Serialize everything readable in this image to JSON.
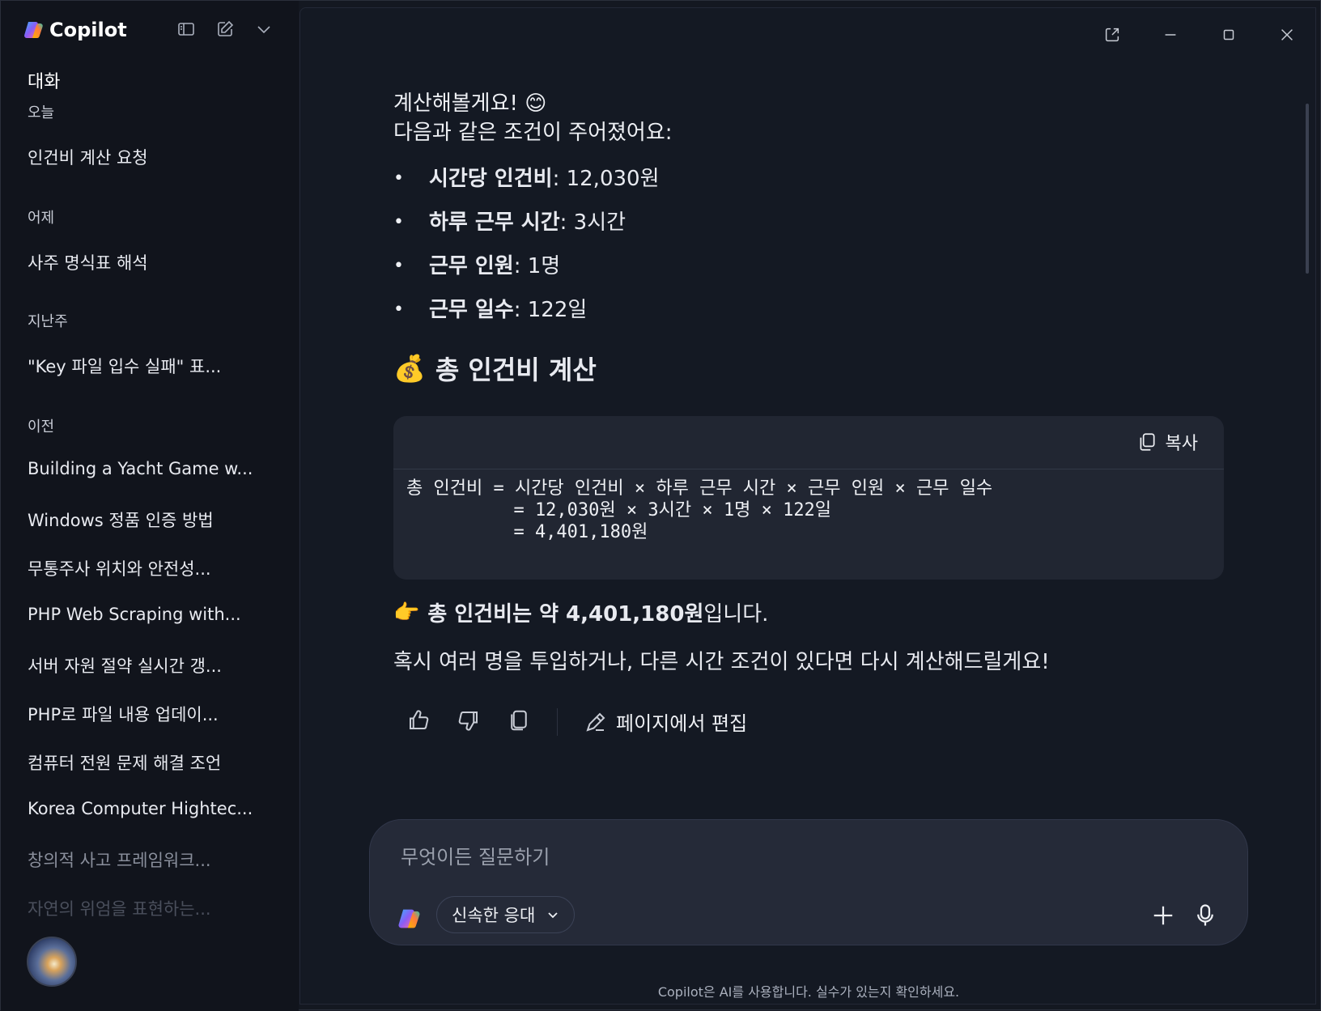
{
  "app": {
    "title": "Copilot"
  },
  "sidebar": {
    "heading": "대화",
    "groups": [
      {
        "label": "오늘",
        "items": [
          "인건비 계산 요청"
        ]
      },
      {
        "label": "어제",
        "items": [
          "사주 명식표 해석"
        ]
      },
      {
        "label": "지난주",
        "items": [
          "\"Key 파일 입수 실패\" 표..."
        ]
      },
      {
        "label": "이전",
        "items": [
          "Building a Yacht Game w...",
          "Windows 정품 인증 방법",
          "무통주사 위치와 안전성...",
          "PHP Web Scraping with...",
          "서버 자원 절약 실시간 갱...",
          "PHP로 파일 내용 업데이...",
          "컴퓨터 전원 문제 해결 조언",
          "Korea Computer Hightec...",
          "창의적 사고 프레임워크...",
          "자연의 위엄을 표현하는..."
        ]
      }
    ]
  },
  "message": {
    "intro_line1": "계산해볼게요! 😊",
    "intro_line2": "다음과 같은 조건이 주어졌어요:",
    "bullets": [
      {
        "label": "시간당 인건비",
        "value": ": 12,030원"
      },
      {
        "label": "하루 근무 시간",
        "value": ": 3시간"
      },
      {
        "label": "근무 인원",
        "value": ": 1명"
      },
      {
        "label": "근무 일수",
        "value": ": 122일"
      }
    ],
    "section_emoji": "💰",
    "section_title": "총 인건비 계산",
    "code_copy_label": "복사",
    "code": "총 인건비 = 시간당 인건비 × 하루 근무 시간 × 근무 인원 × 근무 일수\n          = 12,030원 × 3시간 × 1명 × 122일\n          = 4,401,180원",
    "result_emoji": "👉",
    "result_bold": "총 인건비는 약 4,401,180원",
    "result_tail": "입니다.",
    "followup": "혹시 여러 명을 투입하거나, 다른 시간 조건이 있다면 다시 계산해드릴게요!",
    "edit_label": "페이지에서 편집"
  },
  "composer": {
    "placeholder": "무엇이든 질문하기",
    "mode_label": "신속한 응대"
  },
  "disclaimer": "Copilot은 AI를 사용합니다. 실수가 있는지 확인하세요.",
  "icons": {
    "brand": "copilot-logo",
    "sidebar_toggle": "sidebar-toggle-icon",
    "new_chat": "edit-icon",
    "chevron": "chevron-down-icon",
    "popout": "popout-icon",
    "minimize": "minimize-icon",
    "maximize": "maximize-icon",
    "close": "close-icon",
    "copy": "copy-icon",
    "thumbs_up": "thumbs-up-icon",
    "thumbs_down": "thumbs-down-icon",
    "pen": "pen-icon",
    "plus": "plus-icon",
    "mic": "mic-icon"
  }
}
